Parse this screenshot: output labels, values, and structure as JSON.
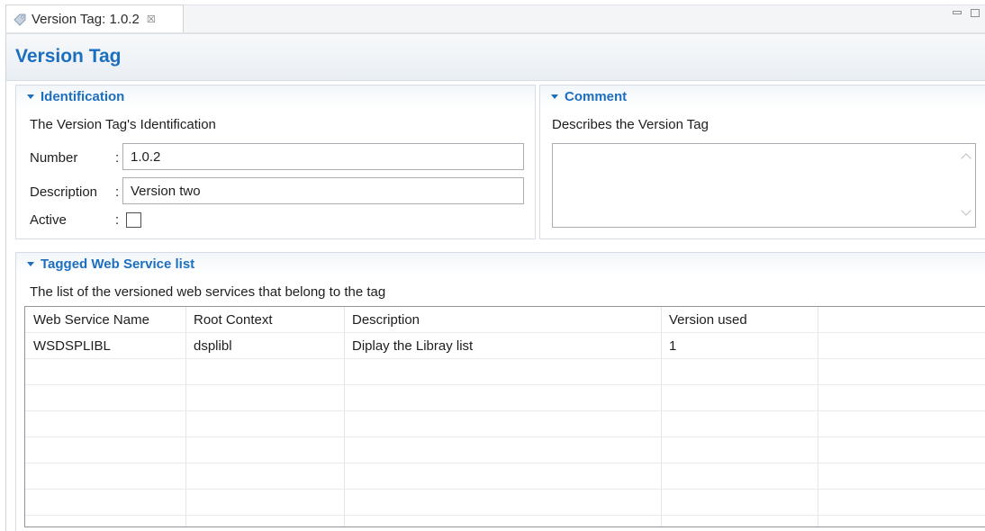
{
  "tab": {
    "label": "Version Tag: 1.0.2",
    "close_glyph": "☒"
  },
  "editor": {
    "title": "Version Tag"
  },
  "identification": {
    "title": "Identification",
    "description": "The Version Tag's Identification",
    "number_label": "Number",
    "number_value": "1.0.2",
    "description_label": "Description",
    "description_value": "Version two",
    "active_label": "Active",
    "active_checked": false,
    "colon": ":"
  },
  "comment": {
    "title": "Comment",
    "description": "Describes the Version Tag",
    "value": ""
  },
  "tagged_list": {
    "title": "Tagged Web Service list",
    "description": "The list of the versioned web services that belong to the tag",
    "columns": [
      "Web Service Name",
      "Root Context",
      "Description",
      "Version used"
    ],
    "rows": [
      [
        "WSDSPLIBL",
        "dsplibl",
        "Diplay the Libray list",
        "1"
      ]
    ]
  },
  "icons": {
    "tab": "tag-icon",
    "minimize": "minimize-icon",
    "maximize": "maximize-icon",
    "twisty": "expand-twisty-icon"
  },
  "colors": {
    "accent": "#1c6fbf",
    "border": "#d6dde4"
  }
}
